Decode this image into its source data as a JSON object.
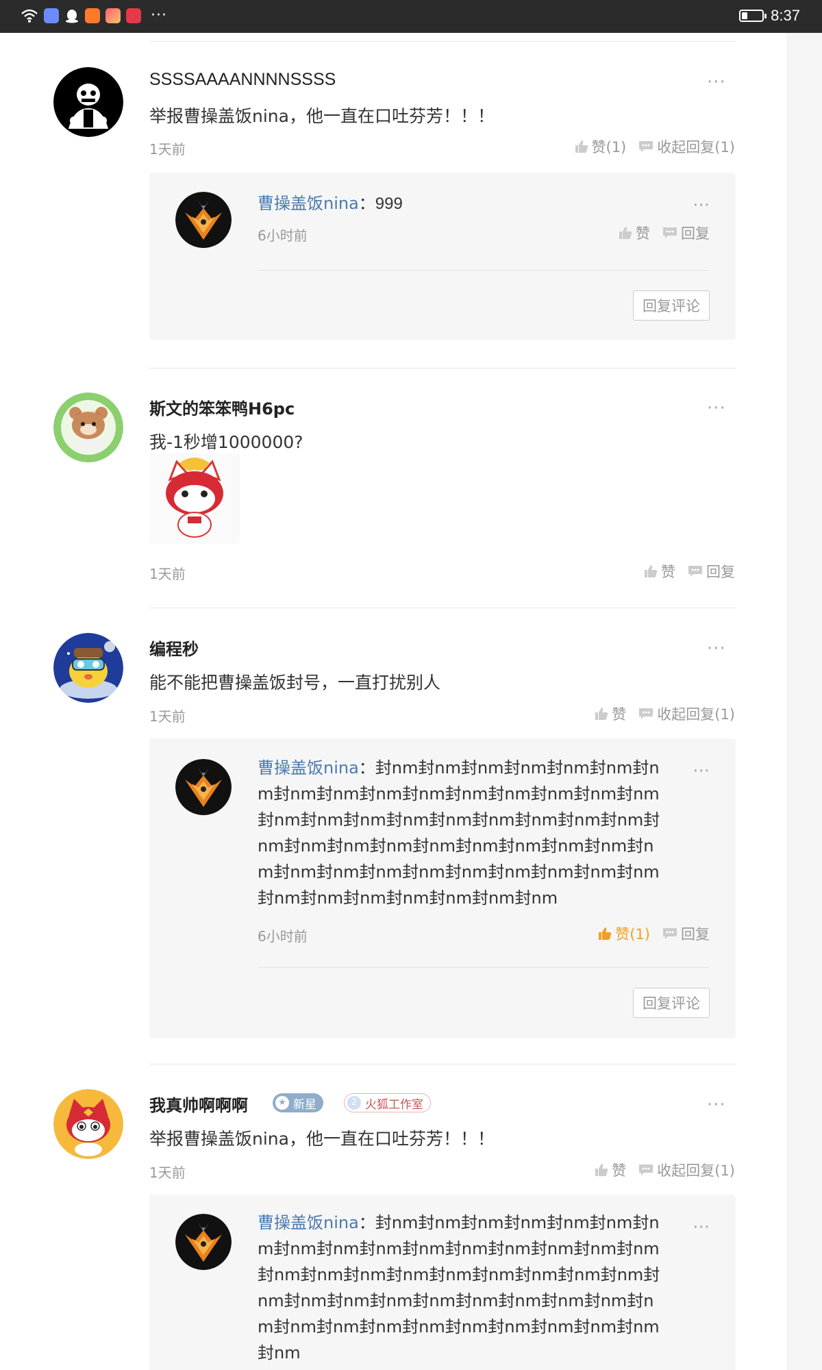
{
  "status_bar": {
    "time": "8:37",
    "more": "···"
  },
  "icons": {
    "more": "···",
    "thumb": "thumb-up-icon",
    "reply": "comment-bubble-icon"
  },
  "comments": [
    {
      "user": "SSSSAAAANNNNSSSS",
      "text": "举报曹操盖饭nina，他一直在口吐芬芳！！！",
      "time": "1天前",
      "like": "赞(1)",
      "reply_toggle": "收起回复(1)",
      "replies": [
        {
          "user": "曹操盖饭nina",
          "sep": "：",
          "text": "999",
          "time": "6小时前",
          "like": "赞",
          "reply": "回复"
        }
      ],
      "reply_comment_button": "回复评论"
    },
    {
      "user": "斯文的笨笨鸭H6pc",
      "text": "我-1秒增1000000?",
      "time": "1天前",
      "like": "赞",
      "reply_toggle": "回复"
    },
    {
      "user": "编程秒",
      "text": "能不能把曹操盖饭封号，一直打扰别人",
      "time": "1天前",
      "like": "赞",
      "reply_toggle": "收起回复(1)",
      "replies": [
        {
          "user": "曹操盖饭nina",
          "sep": "：",
          "text": "封nm封nm封nm封nm封nm封nm封nm封nm封nm封nm封nm封nm封nm封nm封nm封nm封nm封nm封nm封nm封nm封nm封nm封nm封nm封nm封nm封nm封nm封nm封nm封nm封nm封nm封nm封nm封nm封nm封nm封nm封nm封nm封nm封nm封nm封nm封nm封nm封nm封nm封nm",
          "time": "6小时前",
          "like": "赞(1)",
          "reply": "回复"
        }
      ],
      "reply_comment_button": "回复评论"
    },
    {
      "user": "我真帅啊啊啊",
      "badges": [
        "新星",
        "火狐工作室"
      ],
      "badge_level": "2",
      "text": "举报曹操盖饭nina，他一直在口吐芬芳！！！",
      "time": "1天前",
      "like": "赞",
      "reply_toggle": "收起回复(1)",
      "replies": [
        {
          "user": "曹操盖饭nina",
          "sep": "：",
          "text": "封nm封nm封nm封nm封nm封nm封nm封nm封nm封nm封nm封nm封nm封nm封nm封nm封nm封nm封nm封nm封nm封nm封nm封nm封nm封nm封nm封nm封nm封nm封nm封nm封nm封nm封nm封nm封nm封nm封nm封nm封nm封nm封nm封nm封nm"
        }
      ]
    }
  ]
}
